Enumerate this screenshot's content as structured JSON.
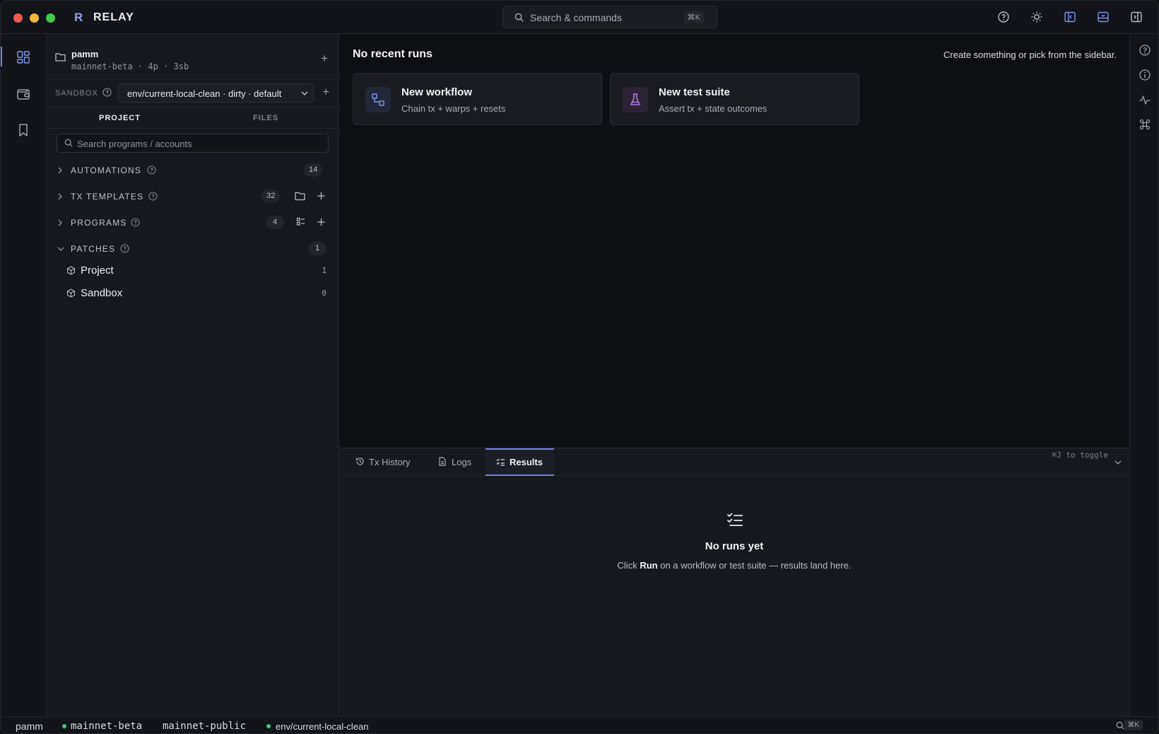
{
  "app": {
    "name": "RELAY",
    "logo_glyph": "R"
  },
  "search": {
    "placeholder": "Search & commands",
    "shortcut": "⌘K"
  },
  "sidebar": {
    "project": {
      "name": "pamm",
      "meta": "mainnet-beta · 4p · 3sb"
    },
    "sandbox": {
      "label": "SANDBOX",
      "value": "env/current-local-clean · dirty · default"
    },
    "tabs": [
      {
        "label": "PROJECT",
        "active": true
      },
      {
        "label": "FILES",
        "active": false
      }
    ],
    "search_placeholder": "Search programs / accounts",
    "sections": [
      {
        "label": "AUTOMATIONS",
        "count": "14",
        "expanded": false
      },
      {
        "label": "TX TEMPLATES",
        "count": "32",
        "expanded": false
      },
      {
        "label": "PROGRAMS",
        "count": "4",
        "expanded": false
      },
      {
        "label": "PATCHES",
        "count": "1",
        "expanded": true
      }
    ],
    "patches": [
      {
        "name": "Project",
        "count": "1"
      },
      {
        "name": "Sandbox",
        "count": "0"
      }
    ]
  },
  "main": {
    "title": "No recent runs",
    "hint": "Create something or pick from the sidebar.",
    "cards": [
      {
        "title": "New workflow",
        "subtitle": "Chain tx + warps + resets",
        "icon": "workflow-icon"
      },
      {
        "title": "New test suite",
        "subtitle": "Assert tx + state outcomes",
        "icon": "flask-icon"
      }
    ]
  },
  "panel": {
    "tabs": [
      {
        "label": "Tx History",
        "icon": "history-icon",
        "active": false
      },
      {
        "label": "Logs",
        "icon": "file-icon",
        "active": false
      },
      {
        "label": "Results",
        "icon": "checklist-icon",
        "active": true
      }
    ],
    "toggle_hint": "⌘J to toggle",
    "empty_title": "No runs yet",
    "empty_pre": "Click ",
    "empty_bold": "Run",
    "empty_post": " on a workflow or test suite — results land here."
  },
  "status": {
    "project": "pamm",
    "cluster": "mainnet-beta",
    "rpc": "mainnet-public",
    "env": "env/current-local-clean",
    "shortcut": "⌘K"
  },
  "colors": {
    "accent": "#6f85e0",
    "status_dot": "#46c27a",
    "workflow_icon": "#7b93ea",
    "flask_icon": "#b07be6"
  }
}
